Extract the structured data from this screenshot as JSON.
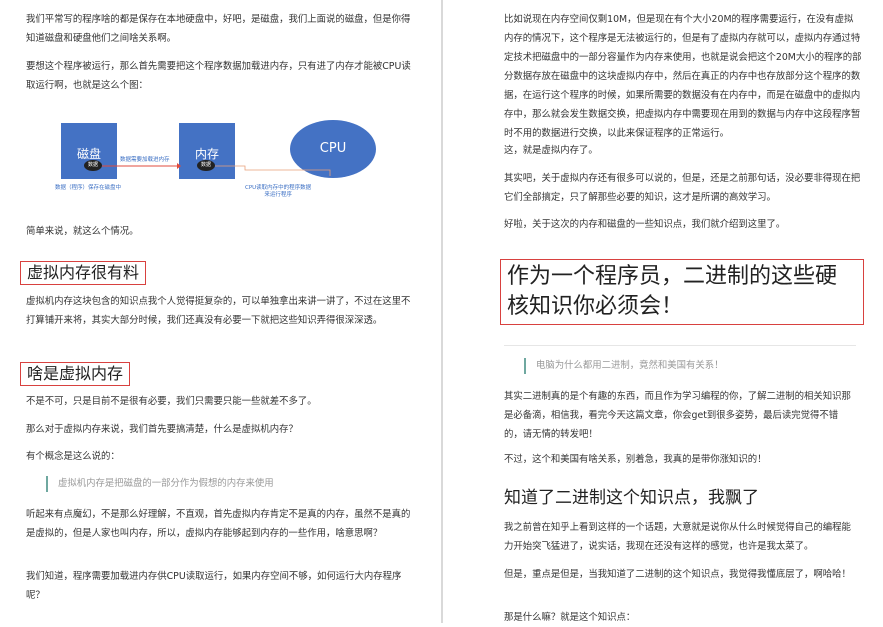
{
  "left": {
    "p1": "我们平常写的程序啥的都是保存在本地硬盘中，好吧，是磁盘，我们上面说的磁盘，但是你得知道磁盘和硬盘他们之间啥关系啊。",
    "p2": "要想这个程序被运行，那么首先需要把这个程序数据加载进内存，只有进了内存才能被CPU读取运行啊，也就是这么个图：",
    "diagram": {
      "disk": "磁盘",
      "memory": "内存",
      "cpu": "CPU",
      "chip": "数据",
      "arrow_label": "数据需要加载进内存",
      "disk_caption": "数据（程序）保存在磁盘中",
      "cpu_caption": "CPU读取内存中的程序数据\n来运行程序"
    },
    "p3": "简单来说，就这么个情况。",
    "h_vm_complex": "虚拟内存很有料",
    "p4": "虚拟机内存这块包含的知识点我个人觉得挺复杂的，可以单独拿出来讲一讲了，不过在这里不打算铺开来将，其实大部分时候，我们还真没有必要一下就把这些知识弄得很深深透。",
    "h_what_vm": "啥是虚拟内存",
    "p5": "不是不可，只是目前不是很有必要，我们只需要只能一些就差不多了。",
    "p6": "那么对于虚拟内存来说，我们首先要搞清楚，什么是虚拟机内存？",
    "p7": "有个概念是这么说的：",
    "quote": "虚拟机内存是把磁盘的一部分作为假想的内存来使用",
    "p8": "听起来有点魔幻，不是那么好理解，不直观，首先虚拟内存肯定不是真的内存，虽然不是真的是虚拟的，但是人家也叫内存，所以，虚拟内存能够起到内存的一些作用，啥意思啊？",
    "p9": "我们知道，程序需要加载进内存供CPU读取运行，如果内存空间不够，如何运行大内存程序呢？"
  },
  "right": {
    "p1": "比如说现在内存空间仅剩10M，但是现在有个大小20M的程序需要运行，在没有虚拟内存的情况下，这个程序是无法被运行的，但是有了虚拟内存就可以，虚拟内存通过特定技术把磁盘中的一部分容量作为内存来使用，也就是说会把这个20M大小的程序的部分数据存放在磁盘中的这块虚拟内存中，然后在真正的内存中也存放部分这个程序的数据，在运行这个程序的时候，如果所需要的数据没有在内存中，而是在磁盘中的虚拟内存中，那么就会发生数据交换，把虚拟内存中需要现在用到的数据与内存中这段程序暂时不用的数据进行交换，以此来保证程序的正常运行。",
    "p2": "这，就是虚拟内存了。",
    "p3": "其实吧，关于虚拟内存还有很多可以说的，但是，还是之前那句话，没必要非得现在把它们全部搞定，只了解那些必要的知识，这才是所谓的高效学习。",
    "p4": "好啦，关于这次的内存和磁盘的一些知识点，我们就介绍到这里了。",
    "big_heading": "作为一个程序员，二进制的这些硬核知识你必须会！",
    "quote": "电脑为什么都用二进制，竟然和美国有关系！",
    "p5": "其实二进制真的是个有趣的东西，而且作为学习编程的你，了解二进制的相关知识那是必备滴，相信我，看完今天这篇文章，你会get到很多姿势，最后读完觉得不错的，请无情的转发吧！",
    "p6": "不过，这个和美国有啥关系，别着急，我真的是带你涨知识的！",
    "h3": "知道了二进制这个知识点，我飘了",
    "p7": "我之前曾在知乎上看到这样的一个话题，大意就是说你从什么时候觉得自己的编程能力开始突飞猛进了，说实话，我现在还没有这样的感觉，也许是我太菜了。",
    "p8": "但是，重点是但是，当我知道了二进制的这个知识点，我觉得我懂底层了，啊哈哈！",
    "p9": "那是什么嘛？就是这个知识点："
  },
  "colors": {
    "box_blue": "#4472c4",
    "heading_border": "#d8413f",
    "quote_bar": "#6fa8a0",
    "arrow_red": "#e04b3c"
  }
}
